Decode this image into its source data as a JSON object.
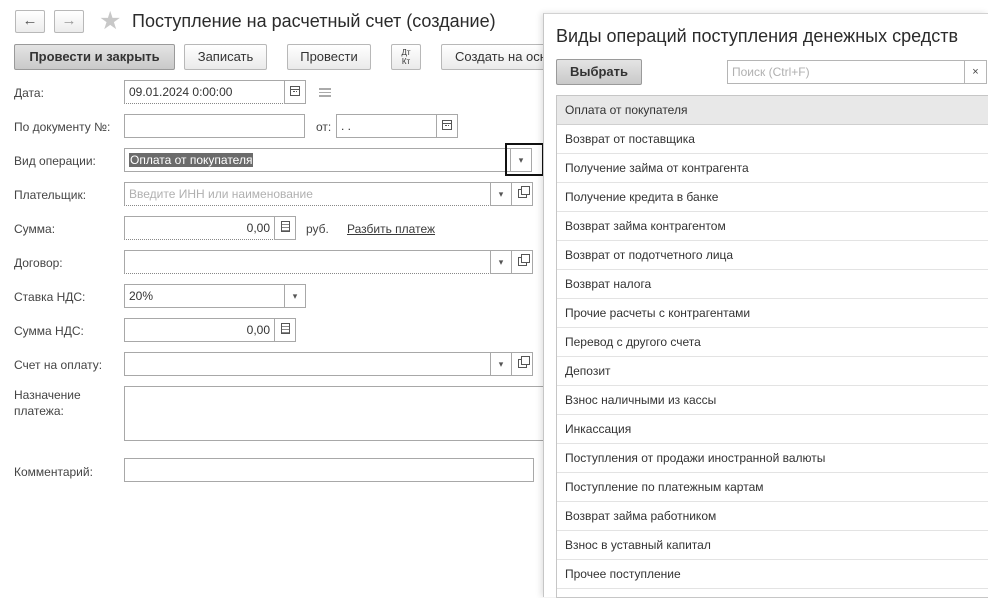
{
  "form": {
    "title": "Поступление на расчетный счет (создание)",
    "nav": {
      "back": "←",
      "forward": "→"
    },
    "toolbar": {
      "post_close": "Провести и закрыть",
      "save": "Записать",
      "post": "Провести",
      "dtkt": "Дт\nКт",
      "create_based": "Создать на основании"
    },
    "fields": {
      "date": {
        "label": "Дата:",
        "value": "09.01.2024  0:00:00"
      },
      "doc_number": {
        "label": "По документу №:",
        "value": "",
        "from_label": "от:",
        "from_value": " .  ."
      },
      "operation": {
        "label": "Вид операции:",
        "value": "Оплата от покупателя"
      },
      "payer": {
        "label": "Плательщик:",
        "placeholder": "Введите ИНН или наименование"
      },
      "amount": {
        "label": "Сумма:",
        "value": "0,00",
        "currency": "руб.",
        "split_link": "Разбить платеж"
      },
      "contract": {
        "label": "Договор:",
        "value": ""
      },
      "vat_rate": {
        "label": "Ставка НДС:",
        "value": "20%"
      },
      "vat_amount": {
        "label": "Сумма НДС:",
        "value": "0,00"
      },
      "invoice": {
        "label": "Счет на оплату:",
        "value": ""
      },
      "purpose": {
        "label_line1": "Назначение",
        "label_line2": "платежа:",
        "value": ""
      },
      "comment": {
        "label": "Комментарий:",
        "value": ""
      }
    }
  },
  "panel": {
    "title": "Виды операций поступления денежных средств",
    "select_button": "Выбрать",
    "search_placeholder": "Поиск (Ctrl+F)",
    "clear": "×",
    "items": [
      "Оплата от покупателя",
      "Возврат от поставщика",
      "Получение займа от контрагента",
      "Получение кредита в банке",
      "Возврат займа контрагентом",
      "Возврат от подотчетного лица",
      "Возврат налога",
      "Прочие расчеты с контрагентами",
      "Перевод с другого счета",
      "Депозит",
      "Взнос наличными из кассы",
      "Инкассация",
      "Поступления от продажи иностранной валюты",
      "Поступление по платежным картам",
      "Возврат займа работником",
      "Взнос в уставный капитал",
      "Прочее поступление"
    ]
  }
}
